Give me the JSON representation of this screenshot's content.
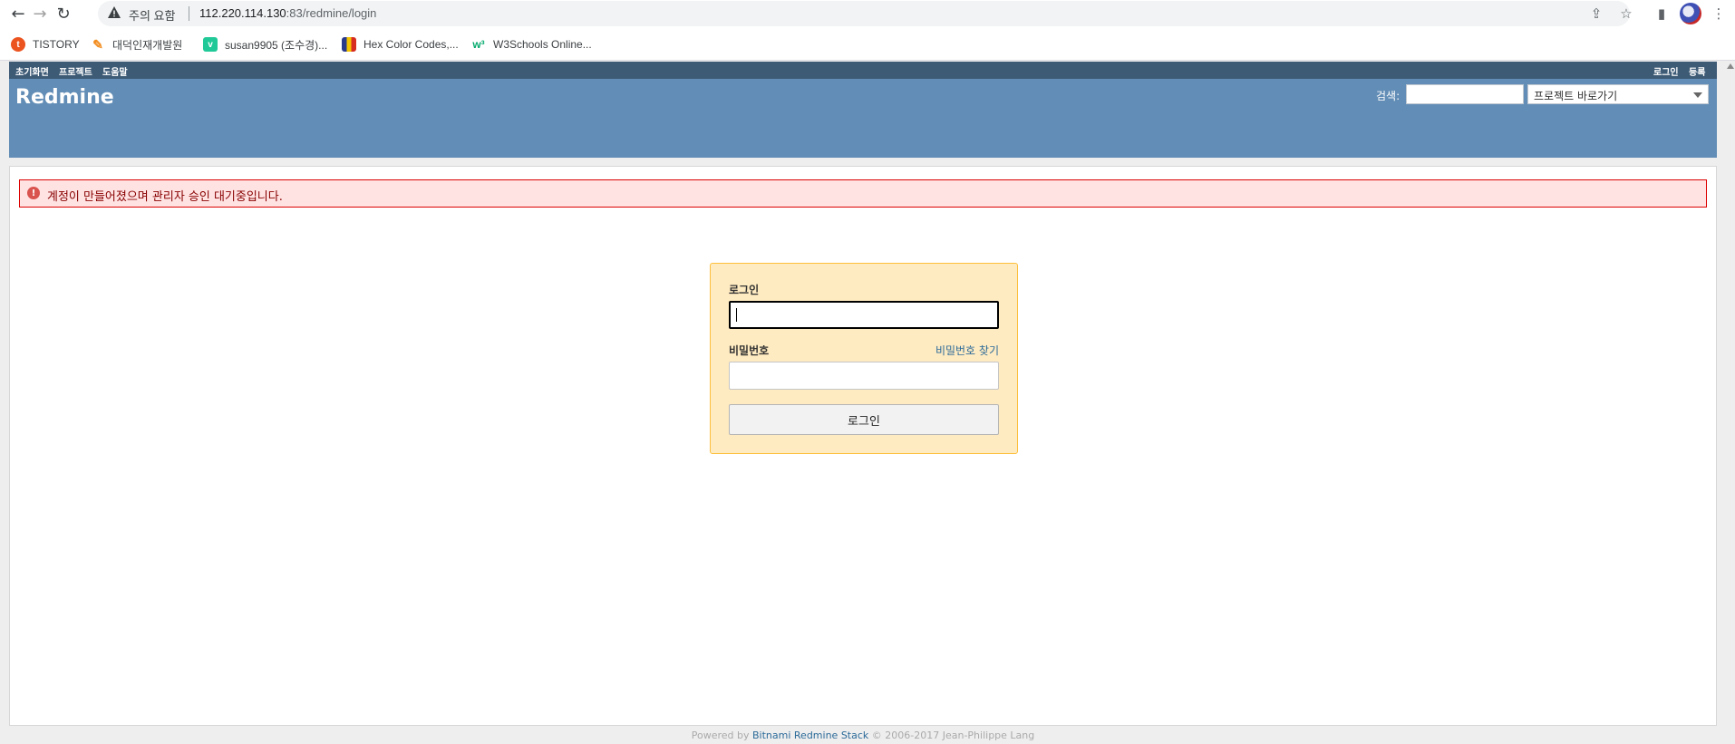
{
  "browser": {
    "security_warning": "주의 요함",
    "url_host": "112.220.114.130",
    "url_path": ":83/redmine/login",
    "bookmarks": [
      {
        "label": "TISTORY",
        "icon": "tistory-icon",
        "color": "#eb531f"
      },
      {
        "label": "대덕인재개발원",
        "icon": "feather-icon",
        "color": "#f28c1e"
      },
      {
        "label": "susan9905 (조수경)...",
        "icon": "velog-icon",
        "color": "#20c997"
      },
      {
        "label": "Hex Color Codes,...",
        "icon": "color-palette-icon",
        "color": "#2a3a8a"
      },
      {
        "label": "W3Schools Online...",
        "icon": "w3schools-icon",
        "color": "#04aa6d"
      }
    ]
  },
  "topmenu": {
    "left": [
      "초기화면",
      "프로젝트",
      "도움말"
    ],
    "right": [
      "로그인",
      "등록"
    ]
  },
  "header": {
    "title": "Redmine",
    "search_label": "검색:",
    "jump_label": "프로젝트 바로가기"
  },
  "flash": {
    "message": "계정이 만들어졌으며 관리자 승인 대기중입니다."
  },
  "login": {
    "username_label": "로그인",
    "password_label": "비밀번호",
    "lost_password": "비밀번호 찾기",
    "submit": "로그인"
  },
  "footer": {
    "prefix": "Powered by ",
    "link": "Bitnami Redmine Stack",
    "suffix": " © 2006-2017 Jean-Philippe Lang"
  }
}
